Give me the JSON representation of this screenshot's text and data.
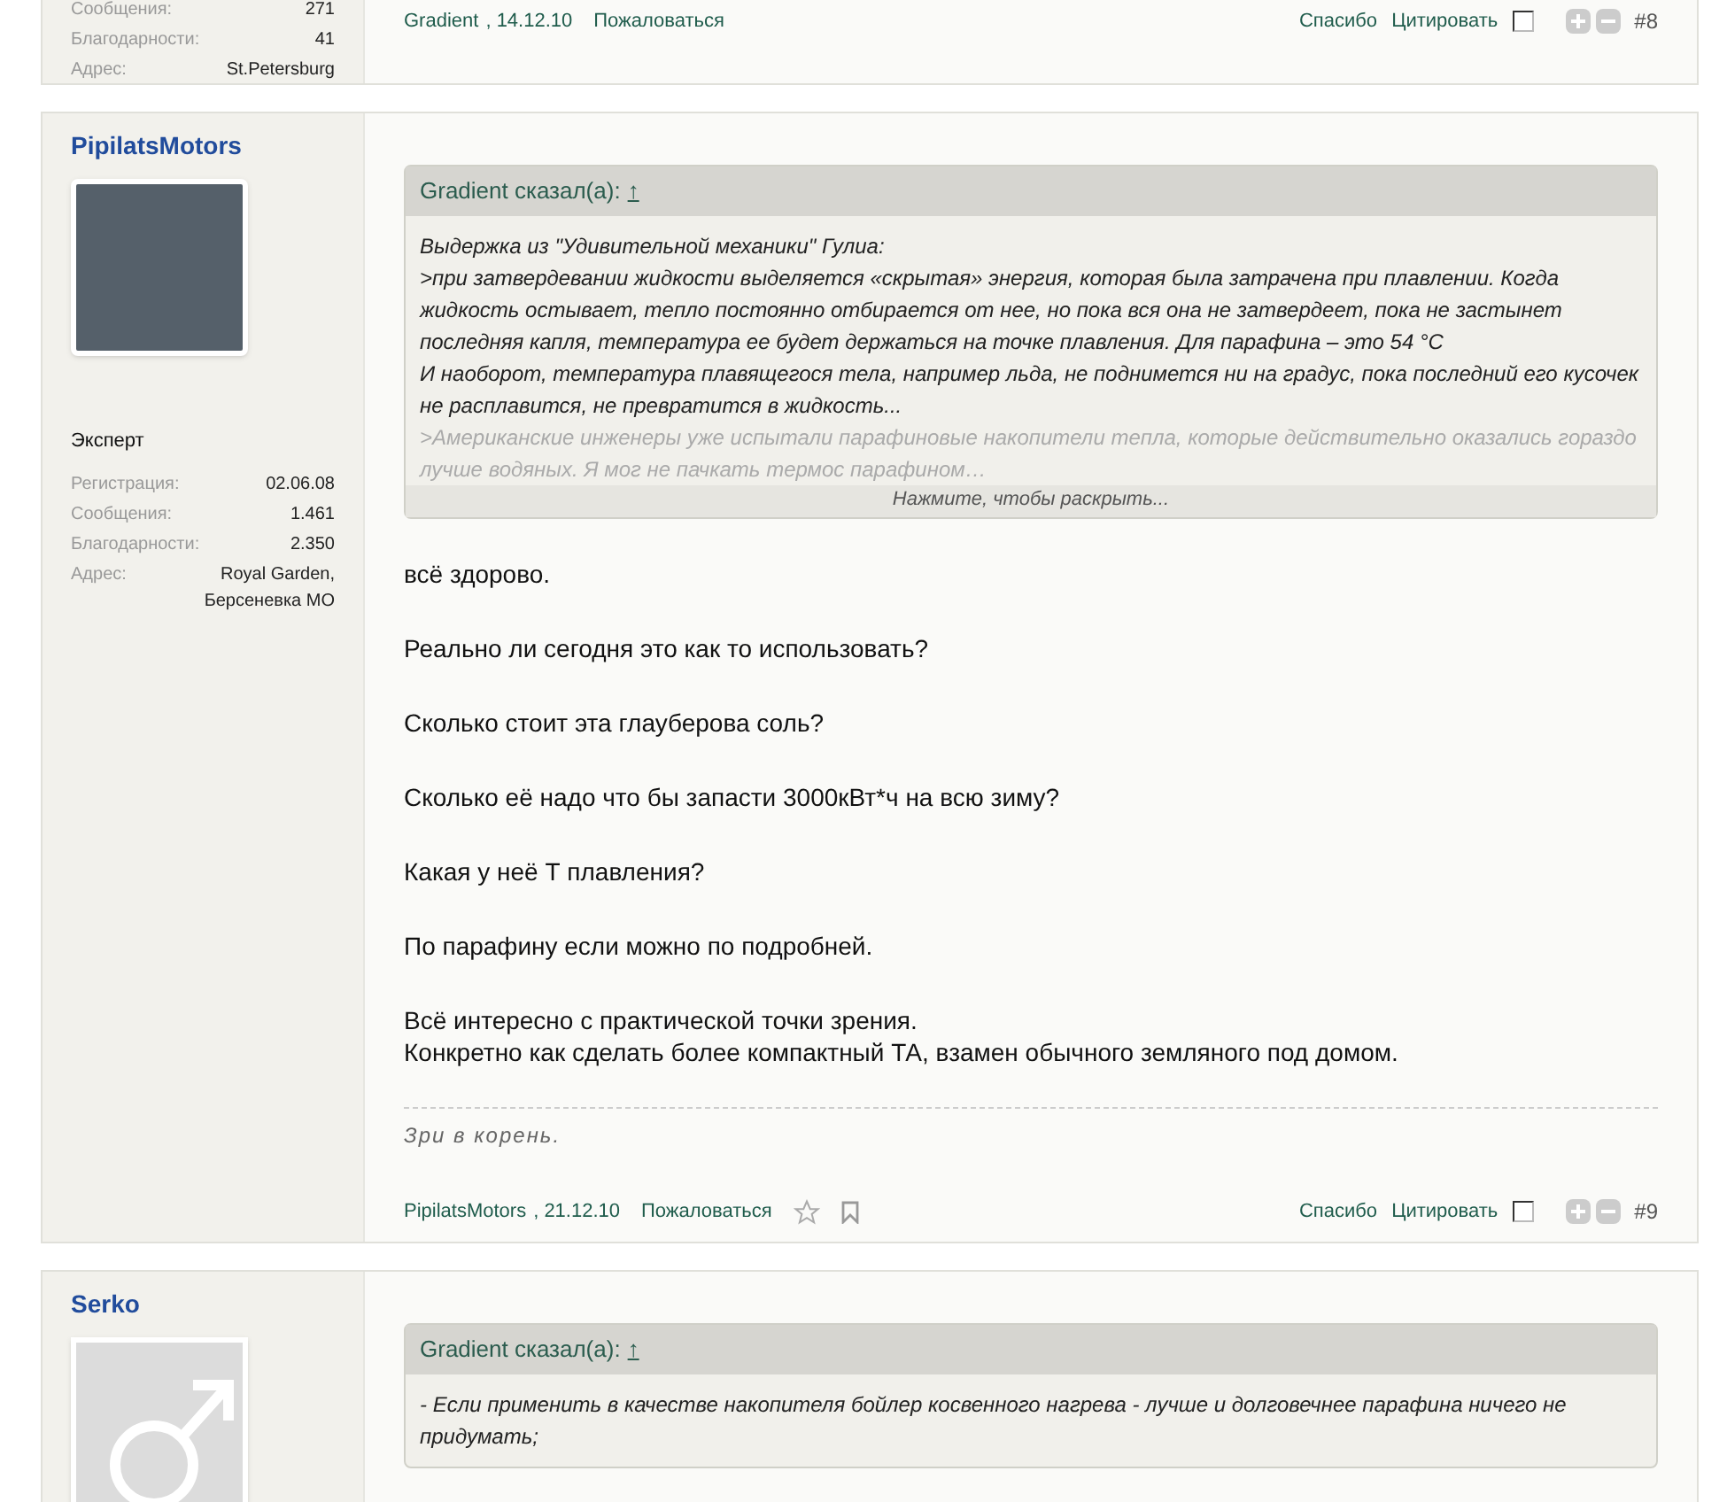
{
  "posts": [
    {
      "stats": [
        {
          "label": "Сообщения:",
          "value": "271"
        },
        {
          "label": "Благодарности:",
          "value": "41"
        },
        {
          "label": "Адрес:",
          "value": "St.Petersburg"
        }
      ],
      "footer": {
        "author": "Gradient",
        "date": ", 14.12.10",
        "report": "Пожаловаться",
        "icons": false,
        "thanks": "Спасибо",
        "quote": "Цитировать",
        "checked": false,
        "number": "#8"
      }
    },
    {
      "author": "PipilatsMotors",
      "has_photo": true,
      "rank": "Эксперт",
      "stats": [
        {
          "label": "Регистрация:",
          "value": "02.06.08"
        },
        {
          "label": "Сообщения:",
          "value": "1.461"
        },
        {
          "label": "Благодарности:",
          "value": "2.350"
        },
        {
          "label": "Адрес:",
          "value": "Royal Garden, Берсеневка МО"
        }
      ],
      "quote": {
        "header": "Gradient сказал(а):",
        "link": "↑",
        "expand": "Нажмите, чтобы раскрыть...",
        "lines": [
          {
            "text": "Выдержка из \"Удивительной механики\" Гулиа:",
            "faded": false
          },
          {
            "text": ">при затвердевании жидкости выделяется «скрытая» энергия, которая была затрачена при плавлении. Когда жидкость остывает, тепло постоянно отбирается от нее, но пока вся она не затвердеет, пока не застынет последняя капля, температура ее будет держаться на точке плавления. Для парафина – это 54 °C",
            "faded": false
          },
          {
            "text": "И наоборот, температура плавящегося тела, например льда, не поднимется ни на градус, пока последний его кусочек не расплавится, не превратится в жидкость...",
            "faded": false
          },
          {
            "text": ">Американские инженеры уже испытали парафиновые накопители тепла, которые действительно оказались гораздо лучше водяных. Я мог не пачкать термос парафином…",
            "faded": true
          }
        ]
      },
      "body": [
        [
          "всё здорово."
        ],
        [
          "Реально ли сегодня это как то использовать?"
        ],
        [
          "Сколько стоит эта глауберова соль?"
        ],
        [
          "Сколько её надо что бы запасти 3000кВт*ч на всю зиму?"
        ],
        [
          "Какая у неё Т плавления?"
        ],
        [
          "По парафину если можно по подробней."
        ],
        [
          "Всё интересно с практической точки зрения.",
          "Конкретно как сделать более компактный ТА, взамен обычного земляного под домом."
        ]
      ],
      "signature": "Зри в корень.",
      "footer": {
        "author": "PipilatsMotors",
        "date": ", 21.12.10",
        "report": "Пожаловаться",
        "icons": true,
        "thanks": "Спасибо",
        "quote": "Цитировать",
        "checked": false,
        "number": "#9"
      }
    },
    {
      "author": "Serko",
      "has_photo": false,
      "quote": {
        "header": "Gradient сказал(а):",
        "link": "↑",
        "lines": [
          {
            "text": "- Если применить в качестве накопителя бойлер косвенного нагрева - лучше и долговечнее парафина ничего не придумать;",
            "faded": false
          }
        ]
      }
    }
  ]
}
